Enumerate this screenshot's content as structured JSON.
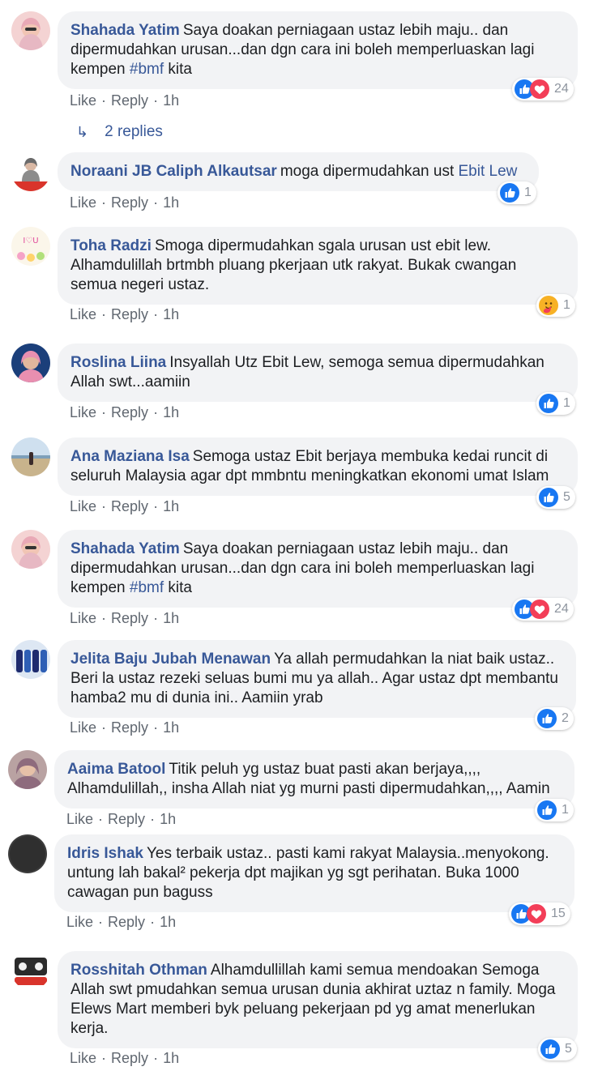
{
  "actions": {
    "like": "Like",
    "reply": "Reply",
    "sep": "·"
  },
  "colors": {
    "link": "#385898",
    "bubble": "#f2f3f5",
    "like_blue": "#1877f2",
    "love_red": "#f33e58"
  },
  "comments": [
    {
      "author": "Shahada Yatim",
      "text_before": "Saya doakan perniagaan ustaz lebih maju.. dan dipermudahkan urusan...dan dgn cara ini boleh memperluaskan lagi kempen ",
      "hashtag": "#bmf",
      "text_after": " kita",
      "time": "1h",
      "reactions": [
        "like-icon",
        "love-icon"
      ],
      "count": "24"
    },
    {
      "author": "Noraani JB Caliph Alkautsar",
      "text_before": "moga dipermudahkan ust ",
      "mention": "Ebit Lew",
      "time": "1h",
      "reactions": [
        "like-icon"
      ],
      "count": "1"
    },
    {
      "author": "Toha Radzi",
      "text": "Smoga dipermudahkan sgala urusan ust ebit lew. Alhamdulillah brtmbh pluang pkerjaan utk rakyat. Bukak cwangan semua negeri ustaz.",
      "time": "1h",
      "reactions": [
        "care-icon"
      ],
      "count": "1"
    },
    {
      "author": "Roslina Liina",
      "text": "Insyallah Utz Ebit Lew, semoga semua dipermudahkan Allah swt...aamiin",
      "time": "1h",
      "reactions": [
        "like-icon"
      ],
      "count": "1"
    },
    {
      "author": "Ana Maziana Isa",
      "text": "Semoga ustaz Ebit berjaya membuka kedai runcit di seluruh Malaysia agar dpt mmbntu meningkatkan ekonomi umat Islam",
      "time": "1h",
      "reactions": [
        "like-icon"
      ],
      "count": "5"
    },
    {
      "author": "Shahada Yatim",
      "text_before": "Saya doakan perniagaan ustaz lebih maju.. dan dipermudahkan urusan...dan dgn cara ini boleh memperluaskan lagi kempen ",
      "hashtag": "#bmf",
      "text_after": " kita",
      "time": "1h",
      "reactions": [
        "like-icon",
        "love-icon"
      ],
      "count": "24"
    },
    {
      "author": "Jelita Baju Jubah Menawan",
      "text": "Ya allah permudahkan la niat baik ustaz.. Beri la ustaz rezeki seluas bumi mu ya allah.. Agar ustaz dpt membantu hamba2 mu di dunia ini.. Aamiin yrab",
      "time": "1h",
      "reactions": [
        "like-icon"
      ],
      "count": "2"
    },
    {
      "author": "Aaima Batool",
      "text": "Titik peluh yg ustaz buat pasti akan berjaya,,,, Alhamdulillah,, insha Allah niat yg murni pasti dipermudahkan,,,, Aamin",
      "time": "1h",
      "reactions": [
        "like-icon"
      ],
      "count": "1"
    },
    {
      "author": "Idris Ishak",
      "text": "Yes terbaik ustaz.. pasti kami rakyat Malaysia..menyokong. untung lah bakal² pekerja dpt majikan yg sgt perihatan. Buka 1000 cawagan pun baguss",
      "time": "1h",
      "reactions": [
        "like-icon",
        "love-icon"
      ],
      "count": "15"
    },
    {
      "author": "Rosshitah Othman",
      "text": "Alhamdullillah kami semua mendoakan Semoga Allah swt pmudahkan semua urusan dunia akhirat uztaz n family. Moga Elews Mart memberi byk peluang pekerjaan pd yg amat menerlukan kerja.",
      "time": "1h",
      "reactions": [
        "like-icon"
      ],
      "count": "5"
    }
  ],
  "replies_label": "2 replies"
}
